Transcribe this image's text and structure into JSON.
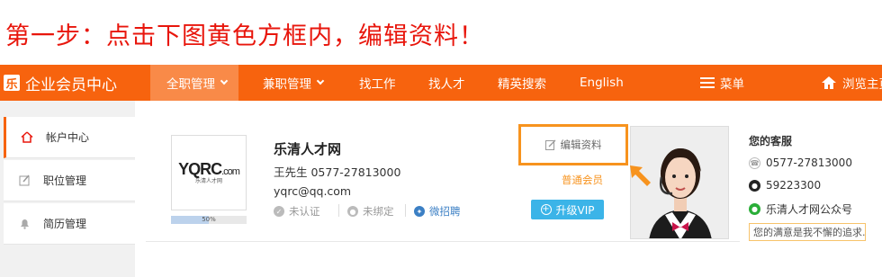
{
  "instruction": "第一步：点击下图黄色方框内，编辑资料！",
  "header": {
    "brand_logo": "乐",
    "brand_title": "企业会员中心",
    "nav": [
      {
        "label": "全职管理",
        "dropdown": true
      },
      {
        "label": "兼职管理",
        "dropdown": true
      },
      {
        "label": "找工作"
      },
      {
        "label": "找人才"
      },
      {
        "label": "精英搜索"
      },
      {
        "label": "English"
      }
    ],
    "menu_label": "菜单",
    "home_label": "浏览主页"
  },
  "sidebar": {
    "items": [
      {
        "label": "帐户中心",
        "icon": "home-icon"
      },
      {
        "label": "职位管理",
        "icon": "edit-icon"
      },
      {
        "label": "简历管理",
        "icon": "bell-icon"
      }
    ]
  },
  "company": {
    "logo_text": "YQRC",
    "logo_suffix": ".com",
    "logo_sub": "乐清人才网",
    "completeness": "50%",
    "completeness_value": 0.5,
    "name": "乐清人才网",
    "contact": "王先生  0577-27813000",
    "email": "yqrc@qq.com",
    "status": [
      {
        "label": "未认证"
      },
      {
        "label": "未绑定"
      },
      {
        "label": "微招聘"
      }
    ]
  },
  "actions": {
    "edit_label": "编辑资料",
    "member_level": "普通会员",
    "vip_label": "升级VIP"
  },
  "service": {
    "title": "您的客服",
    "phone": "0577-27813000",
    "qq": "59223300",
    "wechat": "乐清人才网公众号",
    "slogan": "您的满意是我不懈的追求..."
  },
  "colors": {
    "accent": "#f7630e",
    "highlight": "#f7931e",
    "vip": "#3bb4e8",
    "instruction": "#e8160c"
  }
}
